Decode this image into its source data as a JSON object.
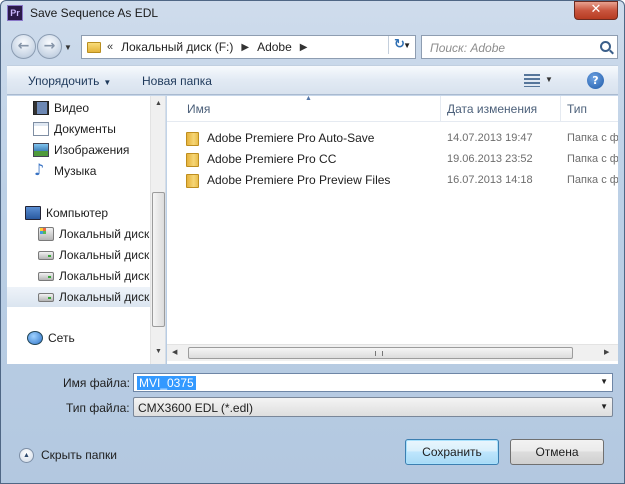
{
  "window": {
    "title": "Save Sequence As EDL",
    "app_icon_text": "Pr",
    "close_symbol": "✕"
  },
  "nav": {
    "back_symbol": "←",
    "forward_symbol": "→",
    "address_chevron": "«",
    "breadcrumbs": [
      "Локальный диск (F:)",
      "Adobe"
    ],
    "refresh_symbol": "↻",
    "search_placeholder": "Поиск: Adobe"
  },
  "toolbar": {
    "organize_label": "Упорядочить",
    "new_folder_label": "Новая папка",
    "help_symbol": "?"
  },
  "sidebar": {
    "items": [
      {
        "label": "Видео",
        "icon": "video-icon"
      },
      {
        "label": "Документы",
        "icon": "documents-icon"
      },
      {
        "label": "Изображения",
        "icon": "images-icon"
      },
      {
        "label": "Музыка",
        "icon": "music-icon"
      },
      {
        "label": "Компьютер",
        "icon": "computer-icon"
      },
      {
        "label": "Локальный диск",
        "icon": "system-drive-icon"
      },
      {
        "label": "Локальный диск",
        "icon": "drive-icon"
      },
      {
        "label": "Локальный диск",
        "icon": "drive-icon"
      },
      {
        "label": "Локальный диск",
        "icon": "drive-icon",
        "selected": true
      },
      {
        "label": "Сеть",
        "icon": "network-icon"
      }
    ]
  },
  "file_list": {
    "columns": [
      "Имя",
      "Дата изменения",
      "Тип"
    ],
    "rows": [
      {
        "name": "Adobe Premiere Pro Auto-Save",
        "date": "14.07.2013 19:47",
        "type": "Папка с ф"
      },
      {
        "name": "Adobe Premiere Pro CC",
        "date": "19.06.2013 23:52",
        "type": "Папка с ф"
      },
      {
        "name": "Adobe Premiere Pro Preview Files",
        "date": "16.07.2013 14:18",
        "type": "Папка с ф"
      }
    ]
  },
  "form": {
    "filename_label": "Имя файла:",
    "filename_value": "MVI_0375",
    "filetype_label": "Тип файла:",
    "filetype_value": "CMX3600 EDL (*.edl)"
  },
  "footer": {
    "hide_folders_label": "Скрыть папки",
    "save_label": "Сохранить",
    "cancel_label": "Отмена"
  },
  "colors": {
    "frame": "#bcd0e6",
    "selection": "#3399ff",
    "default_button": "#bee6fd"
  }
}
